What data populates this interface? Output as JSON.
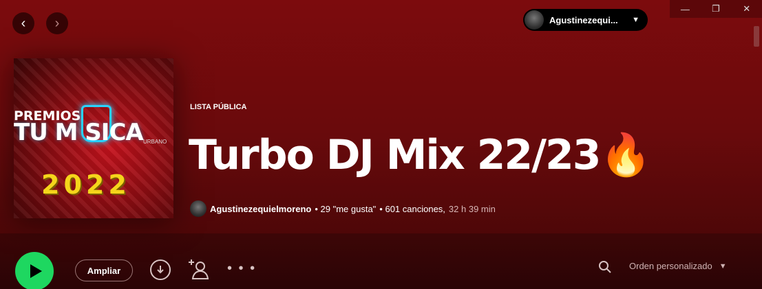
{
  "window": {
    "minimize": "—",
    "restore": "❐",
    "close": "✕"
  },
  "nav": {
    "back": "‹",
    "forward": "›"
  },
  "user": {
    "name": "Agustinezequi...",
    "caret": "▼"
  },
  "cover": {
    "premios": "PREMIOS",
    "tu_musica": "TU M  SICA",
    "urbano": "URBANO",
    "year": "2022"
  },
  "playlist": {
    "type_label": "LISTA PÚBLICA",
    "title": "Turbo DJ Mix 22/23🔥",
    "owner": "Agustinezequielmoreno",
    "likes": "• 29 \"me gusta\"",
    "songs": "• 601 canciones,",
    "duration": "32 h 39 min"
  },
  "actions": {
    "ampliar_label": "Ampliar",
    "more": "• • •",
    "sort_label": "Orden personalizado",
    "sort_caret": "▼"
  },
  "colors": {
    "accent": "#1ed760",
    "header": "#7c0b0d"
  }
}
